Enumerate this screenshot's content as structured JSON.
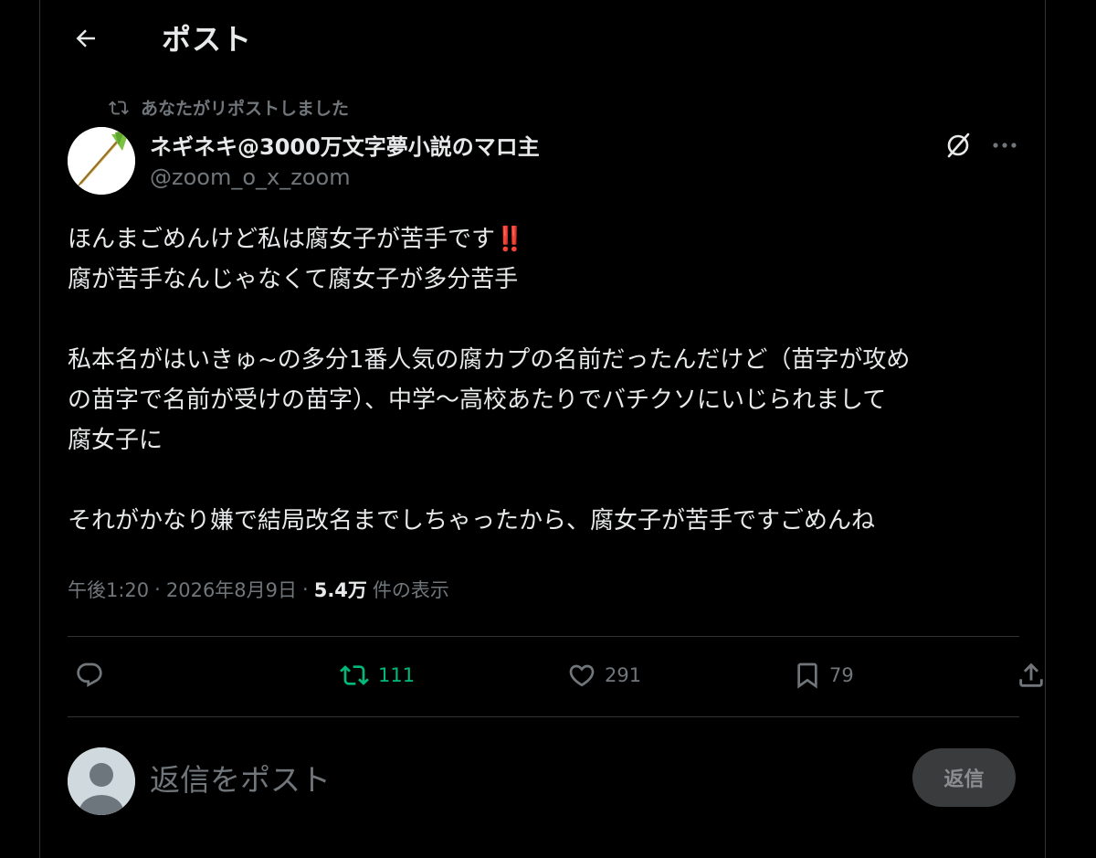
{
  "header": {
    "title": "ポスト"
  },
  "repost_notice": "あなたがリポストしました",
  "author": {
    "display_name": "ネギネキ@3000万文字夢小説のマロ主",
    "handle": "@zoom_o_x_zoom"
  },
  "tweet": {
    "line1": "ほんまごめんけど私は腐女子が苦手です",
    "line1_emoji": "‼️",
    "line2": "腐が苦手なんじゃなくて腐女子が多分苦手",
    "line3": "私本名がはいきゅ~の多分1番人気の腐カプの名前だったんだけど（苗字が攻め",
    "line4": "の苗字で名前が受けの苗字）、中学〜高校あたりでバチクソにいじられまして",
    "line5": "腐女子に",
    "line6": "それがかなり嫌で結局改名までしちゃったから、腐女子が苦手ですごめんね"
  },
  "meta": {
    "time": "午後1:20",
    "separator": "·",
    "date": "2026年8月9日",
    "views": "5.4万",
    "views_label": "件の表示"
  },
  "actions": {
    "reply_count": "",
    "repost_count": "111",
    "like_count": "291",
    "bookmark_count": "79"
  },
  "reply": {
    "placeholder": "返信をポスト",
    "button_label": "返信"
  },
  "colors": {
    "background": "#000000",
    "text_primary": "#e7e9ea",
    "text_secondary": "#71767b",
    "repost_green": "#00ba7c",
    "divider": "#2f3336"
  }
}
